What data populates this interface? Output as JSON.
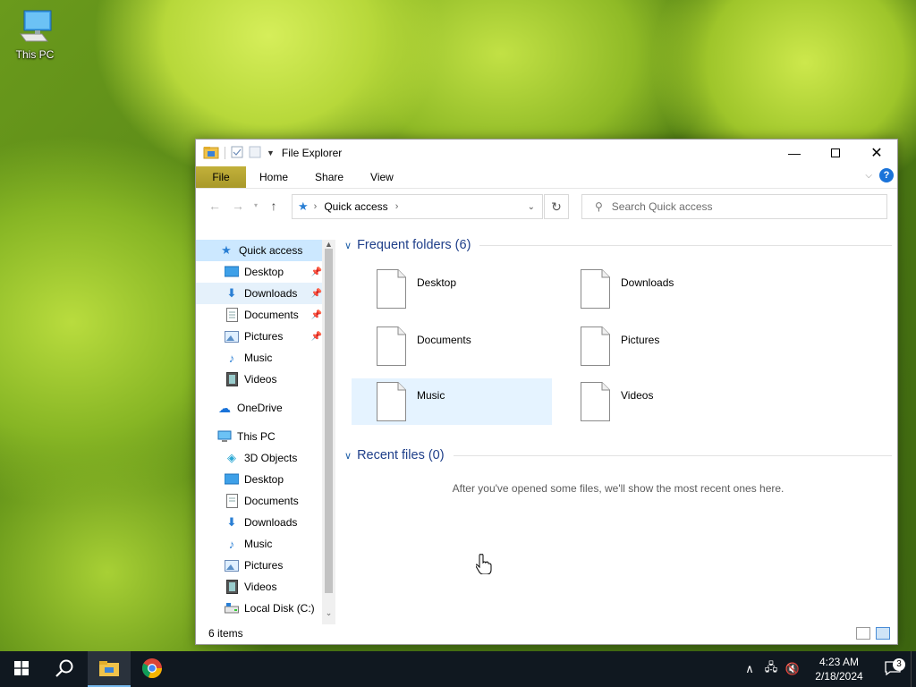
{
  "desktop": {
    "icons": [
      {
        "label": "This PC",
        "icon": "this-pc-icon"
      }
    ]
  },
  "window": {
    "title": "File Explorer",
    "tabs": {
      "file": "File",
      "home": "Home",
      "share": "Share",
      "view": "View"
    },
    "address": {
      "location": "Quick access"
    },
    "search": {
      "placeholder": "Search Quick access"
    },
    "nav": {
      "quick_access": "Quick access",
      "quick_items": [
        {
          "label": "Desktop",
          "icon": "desktop-icon",
          "pinned": true
        },
        {
          "label": "Downloads",
          "icon": "downloads-icon",
          "pinned": true
        },
        {
          "label": "Documents",
          "icon": "documents-icon",
          "pinned": true
        },
        {
          "label": "Pictures",
          "icon": "pictures-icon",
          "pinned": true
        },
        {
          "label": "Music",
          "icon": "music-icon",
          "pinned": false
        },
        {
          "label": "Videos",
          "icon": "videos-icon",
          "pinned": false
        }
      ],
      "onedrive": "OneDrive",
      "this_pc": "This PC",
      "pc_items": [
        {
          "label": "3D Objects",
          "icon": "3d-objects-icon"
        },
        {
          "label": "Desktop",
          "icon": "desktop-icon"
        },
        {
          "label": "Documents",
          "icon": "documents-icon"
        },
        {
          "label": "Downloads",
          "icon": "downloads-icon"
        },
        {
          "label": "Music",
          "icon": "music-icon"
        },
        {
          "label": "Pictures",
          "icon": "pictures-icon"
        },
        {
          "label": "Videos",
          "icon": "videos-icon"
        },
        {
          "label": "Local Disk (C:)",
          "icon": "local-disk-icon"
        }
      ]
    },
    "content": {
      "frequent_header": "Frequent folders (6)",
      "frequent": [
        "Desktop",
        "Downloads",
        "Documents",
        "Pictures",
        "Music",
        "Videos"
      ],
      "selected": "Music",
      "recent_header": "Recent files (0)",
      "recent_empty": "After you've opened some files, we'll show the most recent ones here."
    },
    "status": {
      "items": "6 items"
    }
  },
  "taskbar": {
    "apps": [
      "start-button",
      "search-button",
      "file-explorer",
      "chrome"
    ],
    "clock": {
      "time": "4:23 AM",
      "date": "2/18/2024"
    },
    "notifications": "3"
  },
  "colors": {
    "file_tab": "#b8a82f",
    "accent": "#0078d7",
    "header_text": "#1f3f8a",
    "taskbar": "#101820"
  }
}
